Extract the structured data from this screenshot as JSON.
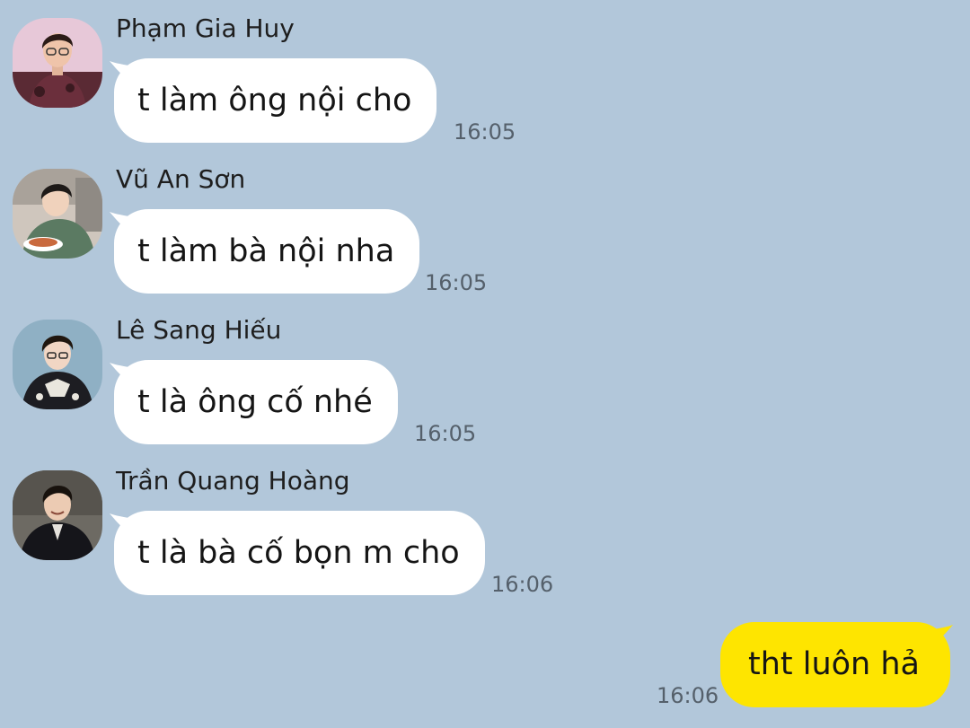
{
  "colors": {
    "background": "#b2c7da",
    "incoming_bubble": "#ffffff",
    "outgoing_bubble": "#fee500"
  },
  "messages": [
    {
      "sender": "Phạm Gia Huy",
      "text": "t làm ông nội cho",
      "time": "16:05",
      "avatar_icon": "avatar-pham-gia-huy"
    },
    {
      "sender": "Vũ An Sơn",
      "text": "t làm bà nội nha",
      "time": "16:05",
      "avatar_icon": "avatar-vu-an-son"
    },
    {
      "sender": "Lê Sang Hiếu",
      "text": "t là ông cố nhé",
      "time": "16:05",
      "avatar_icon": "avatar-le-sang-hieu"
    },
    {
      "sender": "Trần Quang Hoàng",
      "text": "t là bà cố bọn m cho",
      "time": "16:06",
      "avatar_icon": "avatar-tran-quang-hoang"
    }
  ],
  "own_message": {
    "text": "tht luôn hả",
    "time": "16:06"
  }
}
